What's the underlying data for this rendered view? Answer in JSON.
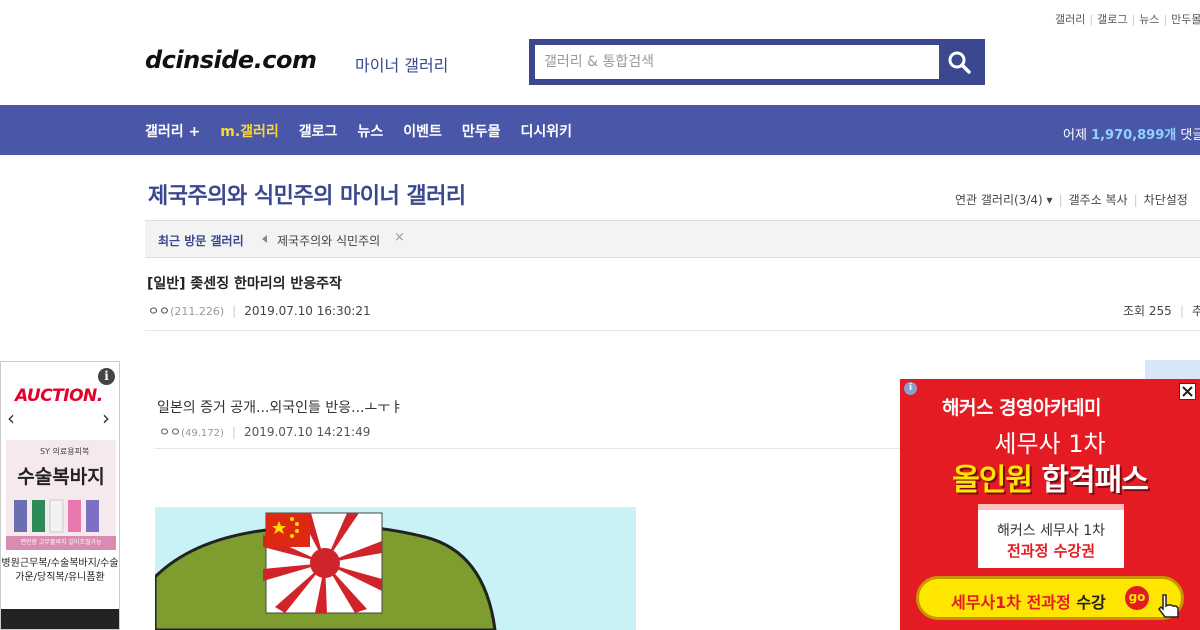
{
  "util_links": [
    "갤러리",
    "갤로그",
    "뉴스",
    "만두몰"
  ],
  "logo": {
    "text": "dcinside.com",
    "sub": "마이너 갤러리"
  },
  "search": {
    "placeholder": "갤러리 & 통합검색",
    "value": ""
  },
  "nav": {
    "items": [
      "갤러리 +",
      "m.갤러리",
      "갤로그",
      "뉴스",
      "이벤트",
      "만두몰",
      "디시위키"
    ],
    "stat_label": "어제",
    "stat_value": "1,970,899개",
    "stat_suffix": "댓글"
  },
  "gallery": {
    "title": "제국주의와 식민주의 마이너 갤러리",
    "tools": [
      "연관 갤러리(3/4)",
      "갤주소 복사",
      "차단설정"
    ]
  },
  "recent": {
    "label": "최근 방문 갤러리",
    "item": "제국주의와 식민주의"
  },
  "post": {
    "title": "[일반] 좆센징 한마리의 반응주작",
    "author": "ㅇㅇ",
    "uid": "(211.226)",
    "date": "2019.07.10 16:30:21",
    "views_label": "조회 255",
    "rec_label": "추"
  },
  "embedded": {
    "title": "일본의 증거 공개...외국인들 반응...ㅗㅜㅑ",
    "author": "ㅇㅇ",
    "uid": "(49.172)",
    "date": "2019.07.10 14:21:49"
  },
  "left_ad": {
    "brand": "AUCTION.",
    "product_brand": "SY 의료용피복",
    "product_text": "수술복바지",
    "product_foot": "편안함 고무줄바지 길이조절가능",
    "desc": "병원근무복/수술복바지/수술가운/당직복/유니폼환"
  },
  "right_ad": {
    "brand": "해커스 경영아카데미",
    "line1": "세무사 1차",
    "line2a": "올인원",
    "line2b": "합격패스",
    "box1": "해커스 세무사 1차",
    "box2": "전과정 수강권",
    "cta_a": "세무사1차 전과정",
    "cta_b": "수강",
    "cta_go": "go"
  },
  "colors": {
    "brand": "#3b4890",
    "nav_bg": "#4a57a8",
    "ad_red": "#e51b23",
    "ad_yellow": "#ffe600"
  }
}
